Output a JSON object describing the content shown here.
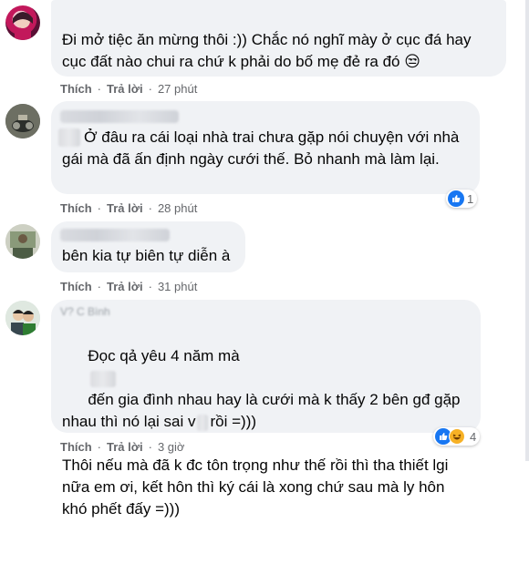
{
  "comments": [
    {
      "text": "Đi mở tiệc ăn mừng thôi :)) Chắc nó nghĩ mày ở cục đá hay cục đất nào chui ra chứ k phải do bố mẹ đẻ ra đó 😒",
      "like_label": "Thích",
      "reply_label": "Trả lời",
      "time": "27 phút"
    },
    {
      "text_prefix": "Ở đâu ra cái loại nhà trai chưa gặp nói chuyện với nhà gái mà đã ấn định ngày cưới thế. Bỏ nhanh mà làm lại.",
      "like_label": "Thích",
      "reply_label": "Trả lời",
      "time": "28 phút",
      "reaction_count": "1"
    },
    {
      "text": "bên kia tự biên tự diễn à",
      "like_label": "Thích",
      "reply_label": "Trả lời",
      "time": "31 phút"
    },
    {
      "name_partial": "V? C      Bình",
      "text_a": "Đọc qả yêu 4 năm mà",
      "text_b": "đến gia đình nhau hay là cưới mà k thấy 2 bên gđ gặp nhau thì nó lại sai v",
      "text_c": "rồi =)))",
      "text_d": "Thôi nếu mà đã k đc tôn trọng như thế rồi thì tha thiết lgi nữa em ơi, kết hôn thì ký cái là xong chứ sau mà ly hôn khó phết đấy =)))",
      "like_label": "Thích",
      "reply_label": "Trả lời",
      "time": "3 giờ",
      "reaction_count": "4"
    }
  ],
  "icons": {
    "like": "like-icon",
    "haha": "haha-icon"
  },
  "colors": {
    "bubble": "#f0f2f5",
    "meta": "#65676b",
    "like_blue": "#1877f2",
    "haha_yellow": "#f7b125"
  }
}
